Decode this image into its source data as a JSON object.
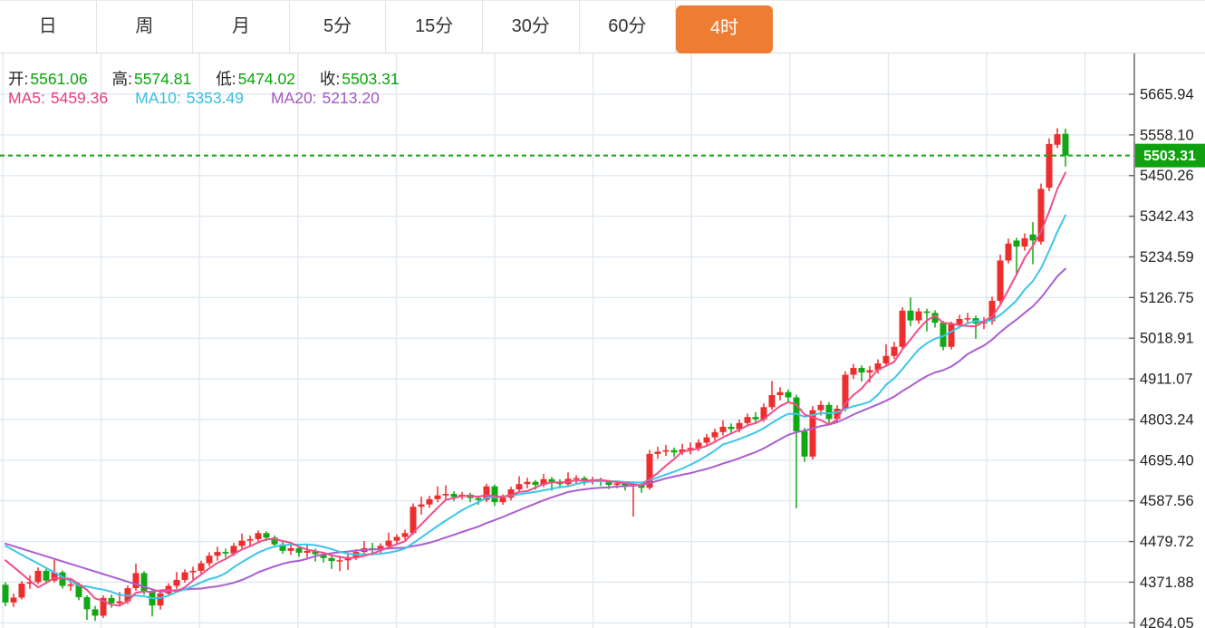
{
  "tabs": {
    "items": [
      {
        "label": "日",
        "selected": false
      },
      {
        "label": "周",
        "selected": false
      },
      {
        "label": "月",
        "selected": false
      },
      {
        "label": "5分",
        "selected": false
      },
      {
        "label": "15分",
        "selected": false
      },
      {
        "label": "30分",
        "selected": false
      },
      {
        "label": "60分",
        "selected": false
      },
      {
        "label": "4时",
        "selected": true
      }
    ],
    "selected_bg_color": "#ee7d33",
    "selected_text_color": "#ffffff"
  },
  "legend": {
    "ohlc": [
      {
        "label": "开:",
        "value": "5561.06"
      },
      {
        "label": "高:",
        "value": "5574.81"
      },
      {
        "label": "低:",
        "value": "5474.02"
      },
      {
        "label": "收:",
        "value": "5503.31"
      }
    ],
    "ohlc_value_color": "#07a507",
    "ma": [
      {
        "label": "MA5:",
        "value": "5459.36",
        "color": "#e2417d"
      },
      {
        "label": "MA10:",
        "value": "5353.49",
        "color": "#38c0dc"
      },
      {
        "label": "MA20:",
        "value": "5213.20",
        "color": "#a557c5"
      }
    ]
  },
  "price_marker": {
    "value": "5503.31",
    "price": 5503.31,
    "badge_color": "#10a010",
    "line_color": "#17a317",
    "text_color": "#ffffff"
  },
  "chart_data": {
    "type": "candlestick",
    "title": "",
    "y_ticks": [
      "5665.94",
      "5558.10",
      "5450.26",
      "5342.43",
      "5234.59",
      "5126.75",
      "5018.91",
      "4911.07",
      "4803.24",
      "4695.40",
      "4587.56",
      "4479.72",
      "4371.88",
      "4264.05"
    ],
    "y_range": [
      4264.05,
      5665.94
    ],
    "grid": true,
    "grid_color": "#dee8f0",
    "axis_line_color": "#606060",
    "tick_label_color": "#222222",
    "up_color": "#ee2d2d",
    "down_color": "#12a714",
    "ma_line_colors": {
      "ma5": "#f04e8c",
      "ma10": "#3cc6e8",
      "ma20": "#ab5fd0"
    },
    "ma_left_anchor": {
      "ma5": 4430,
      "ma10": 4468,
      "ma20": 4474
    },
    "note": "candles are [open, close, low, high]; values estimated from axis gridlines; last candle matches displayed OHLC",
    "candles": [
      [
        4365,
        4318,
        4308,
        4372
      ],
      [
        4318,
        4331,
        4306,
        4342
      ],
      [
        4331,
        4368,
        4326,
        4375
      ],
      [
        4368,
        4372,
        4354,
        4390
      ],
      [
        4372,
        4402,
        4367,
        4411
      ],
      [
        4402,
        4376,
        4369,
        4408
      ],
      [
        4376,
        4398,
        4371,
        4431
      ],
      [
        4398,
        4362,
        4355,
        4403
      ],
      [
        4362,
        4366,
        4349,
        4381
      ],
      [
        4366,
        4332,
        4324,
        4371
      ],
      [
        4332,
        4300,
        4272,
        4337
      ],
      [
        4300,
        4283,
        4269,
        4309
      ],
      [
        4283,
        4330,
        4277,
        4337
      ],
      [
        4330,
        4316,
        4304,
        4339
      ],
      [
        4316,
        4321,
        4307,
        4346
      ],
      [
        4321,
        4356,
        4314,
        4363
      ],
      [
        4356,
        4396,
        4349,
        4421
      ],
      [
        4396,
        4348,
        4339,
        4401
      ],
      [
        4348,
        4310,
        4281,
        4353
      ],
      [
        4310,
        4342,
        4299,
        4349
      ],
      [
        4342,
        4362,
        4335,
        4369
      ],
      [
        4362,
        4378,
        4354,
        4399
      ],
      [
        4378,
        4398,
        4371,
        4406
      ],
      [
        4398,
        4402,
        4379,
        4413
      ],
      [
        4402,
        4422,
        4394,
        4429
      ],
      [
        4422,
        4442,
        4414,
        4451
      ],
      [
        4442,
        4452,
        4429,
        4466
      ],
      [
        4452,
        4448,
        4437,
        4461
      ],
      [
        4448,
        4468,
        4441,
        4476
      ],
      [
        4468,
        4482,
        4461,
        4501
      ],
      [
        4482,
        4486,
        4469,
        4496
      ],
      [
        4486,
        4502,
        4479,
        4509
      ],
      [
        4502,
        4490,
        4481,
        4507
      ],
      [
        4490,
        4472,
        4464,
        4496
      ],
      [
        4472,
        4455,
        4447,
        4479
      ],
      [
        4455,
        4462,
        4444,
        4469
      ],
      [
        4462,
        4450,
        4439,
        4467
      ],
      [
        4450,
        4455,
        4437,
        4473
      ],
      [
        4455,
        4446,
        4427,
        4461
      ],
      [
        4446,
        4436,
        4424,
        4451
      ],
      [
        4436,
        4428,
        4407,
        4443
      ],
      [
        4428,
        4430,
        4401,
        4439
      ],
      [
        4430,
        4438,
        4404,
        4445
      ],
      [
        4438,
        4452,
        4431,
        4459
      ],
      [
        4452,
        4462,
        4444,
        4481
      ],
      [
        4462,
        4458,
        4447,
        4476
      ],
      [
        4458,
        4468,
        4449,
        4475
      ],
      [
        4468,
        4482,
        4459,
        4503
      ],
      [
        4482,
        4492,
        4474,
        4499
      ],
      [
        4492,
        4502,
        4484,
        4511
      ],
      [
        4502,
        4572,
        4497,
        4581
      ],
      [
        4572,
        4578,
        4551,
        4599
      ],
      [
        4578,
        4592,
        4569,
        4601
      ],
      [
        4592,
        4602,
        4584,
        4626
      ],
      [
        4602,
        4606,
        4589,
        4629
      ],
      [
        4606,
        4598,
        4587,
        4613
      ],
      [
        4598,
        4604,
        4591,
        4611
      ],
      [
        4604,
        4595,
        4584,
        4609
      ],
      [
        4595,
        4590,
        4577,
        4601
      ],
      [
        4590,
        4626,
        4584,
        4633
      ],
      [
        4626,
        4584,
        4574,
        4631
      ],
      [
        4584,
        4596,
        4577,
        4605
      ],
      [
        4596,
        4618,
        4589,
        4625
      ],
      [
        4618,
        4632,
        4611,
        4653
      ],
      [
        4632,
        4638,
        4621,
        4649
      ],
      [
        4638,
        4630,
        4617,
        4643
      ],
      [
        4630,
        4645,
        4624,
        4659
      ],
      [
        4645,
        4638,
        4614,
        4651
      ],
      [
        4638,
        4632,
        4621,
        4645
      ],
      [
        4632,
        4646,
        4627,
        4663
      ],
      [
        4646,
        4648,
        4634,
        4656
      ],
      [
        4648,
        4640,
        4629,
        4653
      ],
      [
        4640,
        4644,
        4631,
        4651
      ],
      [
        4644,
        4638,
        4627,
        4649
      ],
      [
        4638,
        4630,
        4619,
        4643
      ],
      [
        4630,
        4634,
        4621,
        4641
      ],
      [
        4634,
        4626,
        4615,
        4639
      ],
      [
        4626,
        4630,
        4546,
        4639
      ],
      [
        4630,
        4622,
        4609,
        4635
      ],
      [
        4622,
        4712,
        4617,
        4723
      ],
      [
        4712,
        4718,
        4699,
        4731
      ],
      [
        4718,
        4722,
        4707,
        4736
      ],
      [
        4722,
        4716,
        4704,
        4729
      ],
      [
        4716,
        4724,
        4709,
        4739
      ],
      [
        4724,
        4728,
        4711,
        4743
      ],
      [
        4728,
        4742,
        4719,
        4751
      ],
      [
        4742,
        4756,
        4735,
        4765
      ],
      [
        4756,
        4770,
        4747,
        4779
      ],
      [
        4770,
        4784,
        4761,
        4801
      ],
      [
        4784,
        4778,
        4765,
        4793
      ],
      [
        4778,
        4794,
        4769,
        4803
      ],
      [
        4794,
        4810,
        4785,
        4819
      ],
      [
        4810,
        4804,
        4791,
        4823
      ],
      [
        4804,
        4836,
        4797,
        4846
      ],
      [
        4836,
        4868,
        4829,
        4906
      ],
      [
        4868,
        4876,
        4854,
        4889
      ],
      [
        4876,
        4862,
        4849,
        4883
      ],
      [
        4862,
        4772,
        4568,
        4869
      ],
      [
        4772,
        4705,
        4691,
        4781
      ],
      [
        4705,
        4828,
        4697,
        4839
      ],
      [
        4828,
        4842,
        4814,
        4853
      ],
      [
        4842,
        4805,
        4794,
        4849
      ],
      [
        4805,
        4832,
        4797,
        4841
      ],
      [
        4832,
        4922,
        4825,
        4931
      ],
      [
        4922,
        4940,
        4911,
        4951
      ],
      [
        4940,
        4928,
        4904,
        4947
      ],
      [
        4928,
        4934,
        4901,
        4945
      ],
      [
        4934,
        4952,
        4925,
        4963
      ],
      [
        4952,
        4972,
        4944,
        5003
      ],
      [
        4972,
        4996,
        4964,
        5009
      ],
      [
        4996,
        5092,
        4989,
        5101
      ],
      [
        5092,
        5066,
        5051,
        5127
      ],
      [
        5066,
        5090,
        5057,
        5099
      ],
      [
        5090,
        5086,
        5037,
        5097
      ],
      [
        5086,
        5060,
        5047,
        5093
      ],
      [
        5060,
        4996,
        4987,
        5065
      ],
      [
        4996,
        5056,
        4989,
        5063
      ],
      [
        5056,
        5070,
        5045,
        5081
      ],
      [
        5070,
        5072,
        5057,
        5086
      ],
      [
        5072,
        5058,
        5017,
        5079
      ],
      [
        5058,
        5064,
        5043,
        5075
      ],
      [
        5064,
        5118,
        5055,
        5129
      ],
      [
        5118,
        5225,
        5109,
        5241
      ],
      [
        5225,
        5270,
        5217,
        5283
      ],
      [
        5278,
        5262,
        5187,
        5285
      ],
      [
        5262,
        5284,
        5251,
        5297
      ],
      [
        5294,
        5278,
        5215,
        5327
      ],
      [
        5275,
        5415,
        5267,
        5429
      ],
      [
        5418,
        5534,
        5409,
        5549
      ],
      [
        5532,
        5560,
        5523,
        5576
      ],
      [
        5561.06,
        5503.31,
        5474.02,
        5574.81
      ]
    ]
  }
}
